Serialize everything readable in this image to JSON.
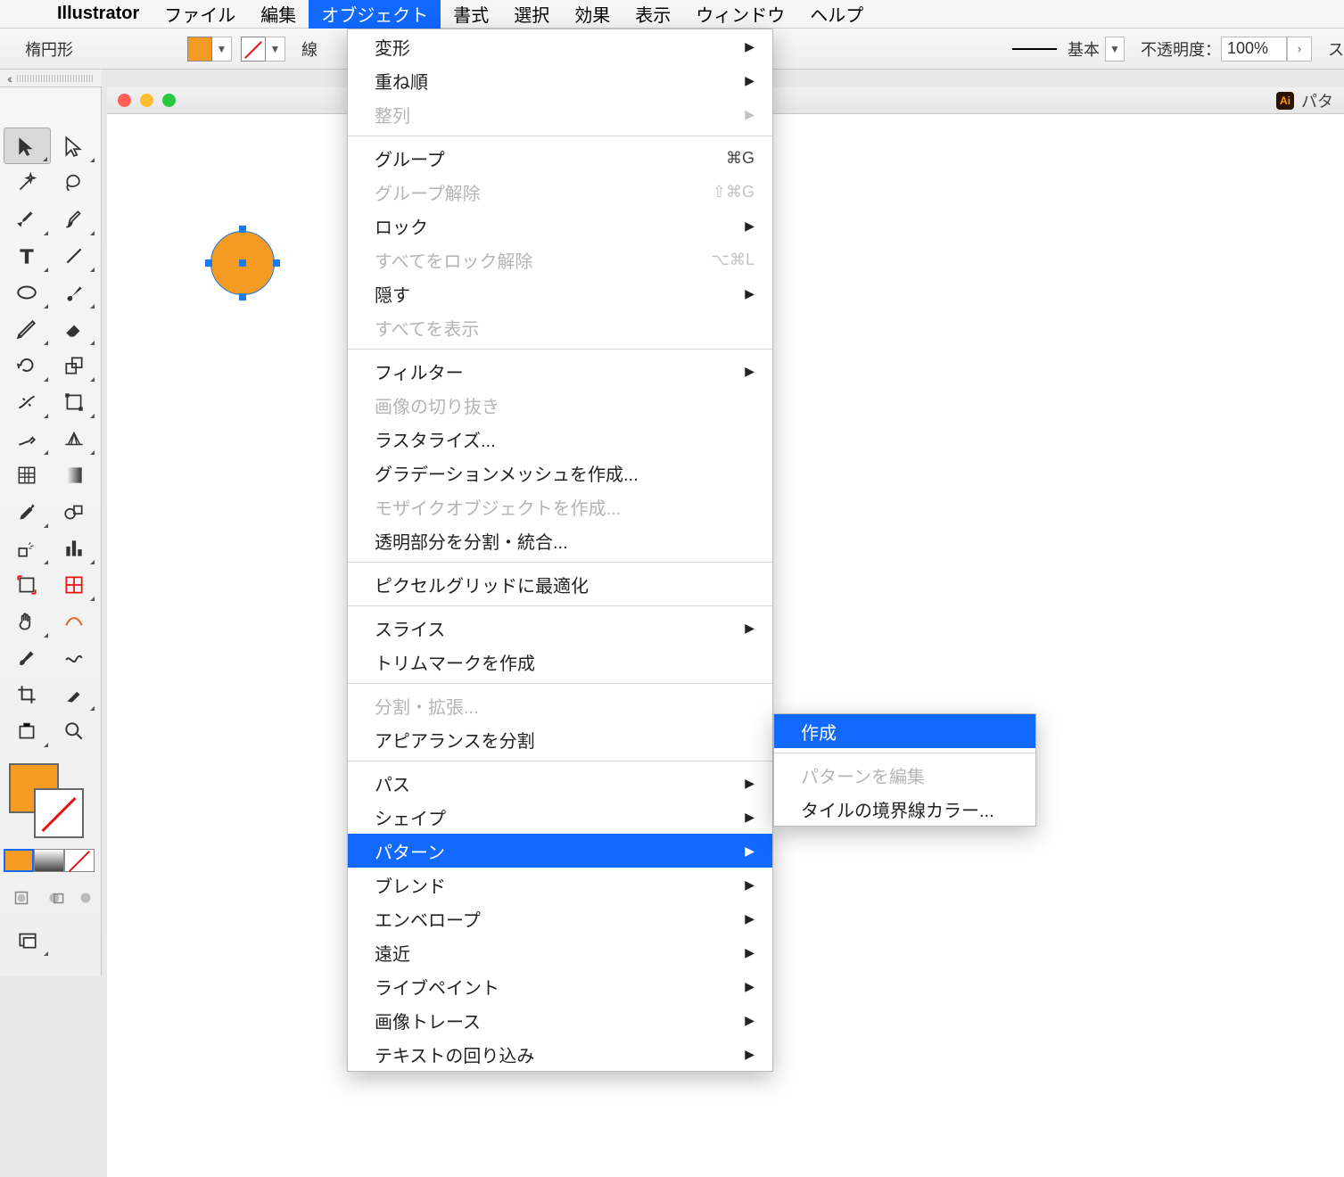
{
  "menubar": {
    "app": "Illustrator",
    "items": [
      "ファイル",
      "編集",
      "オブジェクト",
      "書式",
      "選択",
      "効果",
      "表示",
      "ウィンドウ",
      "ヘルプ"
    ]
  },
  "controlbar": {
    "shape": "楕円形",
    "stroke_label": "線",
    "basic": "基本",
    "opacity_label": "不透明度：",
    "opacity_value": "100%",
    "style_cut": "ス"
  },
  "docbar": {
    "badge": "Ai",
    "right_text": "パタ"
  },
  "object_menu": [
    {
      "label": "変形",
      "sub": true
    },
    {
      "label": "重ね順",
      "sub": true
    },
    {
      "label": "整列",
      "sub": true,
      "disabled": true
    },
    {
      "sep": true
    },
    {
      "label": "グループ",
      "shortcut": "⌘G"
    },
    {
      "label": "グループ解除",
      "shortcut": "⇧⌘G",
      "disabled": true
    },
    {
      "label": "ロック",
      "sub": true
    },
    {
      "label": "すべてをロック解除",
      "shortcut": "⌥⌘L",
      "disabled": true
    },
    {
      "label": "隠す",
      "sub": true
    },
    {
      "label": "すべてを表示",
      "disabled": true
    },
    {
      "sep": true
    },
    {
      "label": "フィルター",
      "sub": true
    },
    {
      "label": "画像の切り抜き",
      "disabled": true
    },
    {
      "label": "ラスタライズ..."
    },
    {
      "label": "グラデーションメッシュを作成..."
    },
    {
      "label": "モザイクオブジェクトを作成...",
      "disabled": true
    },
    {
      "label": "透明部分を分割・統合..."
    },
    {
      "sep": true
    },
    {
      "label": "ピクセルグリッドに最適化"
    },
    {
      "sep": true
    },
    {
      "label": "スライス",
      "sub": true
    },
    {
      "label": "トリムマークを作成"
    },
    {
      "sep": true
    },
    {
      "label": "分割・拡張...",
      "disabled": true
    },
    {
      "label": "アピアランスを分割"
    },
    {
      "sep": true
    },
    {
      "label": "パス",
      "sub": true
    },
    {
      "label": "シェイプ",
      "sub": true
    },
    {
      "label": "パターン",
      "sub": true,
      "hl": true
    },
    {
      "label": "ブレンド",
      "sub": true
    },
    {
      "label": "エンベロープ",
      "sub": true
    },
    {
      "label": "遠近",
      "sub": true
    },
    {
      "label": "ライブペイント",
      "sub": true
    },
    {
      "label": "画像トレース",
      "sub": true
    },
    {
      "label": "テキストの回り込み",
      "sub": true
    }
  ],
  "sub_menu": [
    {
      "label": "作成",
      "hl": true
    },
    {
      "sep": true
    },
    {
      "label": "パターンを編集",
      "disabled": true
    },
    {
      "label": "タイルの境界線カラー..."
    }
  ]
}
